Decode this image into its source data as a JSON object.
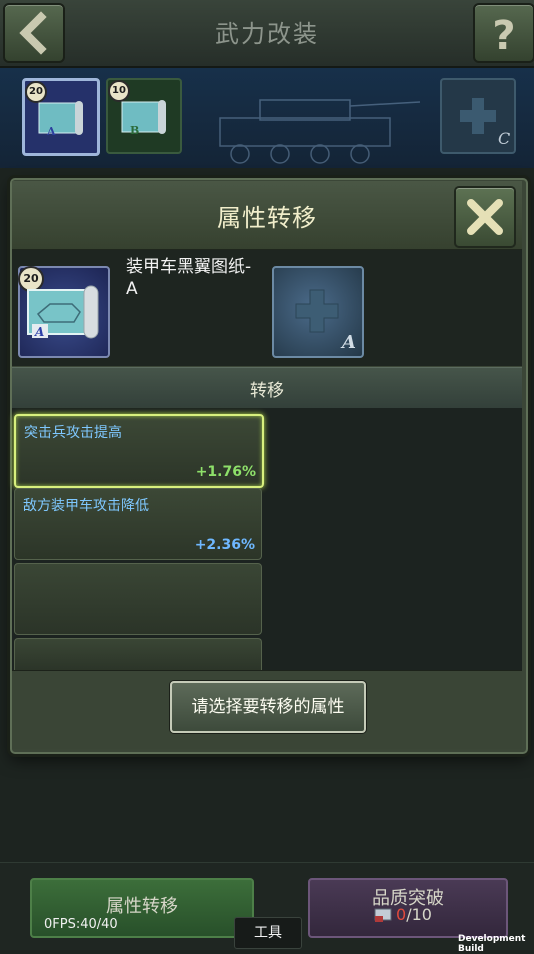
{
  "screen": {
    "title": "武力改装",
    "back_icon": "chevron-left-icon",
    "help_icon": "question-icon"
  },
  "blueprint_slots": [
    {
      "level": "20",
      "grade": "A"
    },
    {
      "level": "10",
      "grade": "B"
    },
    {
      "grade": "C",
      "empty": true
    }
  ],
  "modal": {
    "title": "属性转移",
    "close_icon": "close-x-icon",
    "item": {
      "level": "20",
      "name": "装甲车黑翼图纸-A",
      "grade": "A"
    },
    "target_slot": {
      "grade": "A",
      "icon": "plus-icon"
    },
    "section_label": "转移",
    "attributes": [
      {
        "name": "突击兵攻击提高",
        "value": "+1.76%",
        "color": "#8ee06a",
        "selected": true
      },
      {
        "name": "敌方装甲车攻击降低",
        "value": "+2.36%",
        "color": "#6fb8ff",
        "selected": false
      }
    ],
    "select_button": "请选择要转移的属性"
  },
  "bottom": {
    "tab1_label": "属性转移",
    "tab2_label": "品质突破",
    "count_have": "0",
    "count_total": "/10",
    "fps": "0FPS:40/40",
    "tool_button": "工具",
    "dev_build": "Development Build"
  }
}
